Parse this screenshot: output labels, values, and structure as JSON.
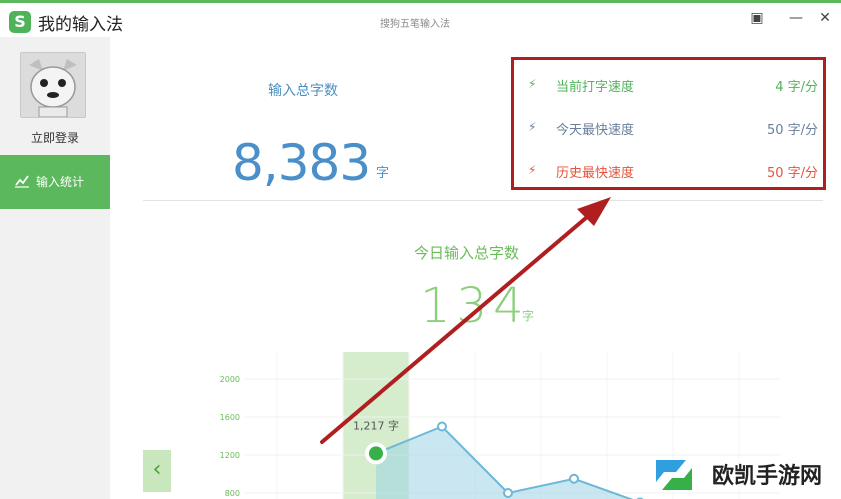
{
  "window": {
    "app_title": "我的输入法",
    "subtitle": "搜狗五笔输入法",
    "logo_letter": "S",
    "buttons": {
      "skin": "▣",
      "minimize": "—",
      "close": "✕"
    }
  },
  "sidebar": {
    "login_label": "立即登录",
    "nav_stats_label": "输入统计"
  },
  "totals": {
    "label": "输入总字数",
    "value": "8,383",
    "unit": "字"
  },
  "speeds": [
    {
      "name": "当前打字速度",
      "value": "4  字/分",
      "color": "#4fb35a"
    },
    {
      "name": "今天最快速度",
      "value": "50 字/分",
      "color": "#6a7f9c"
    },
    {
      "name": "历史最快速度",
      "value": "50 字/分",
      "color": "#e5533d"
    }
  ],
  "today": {
    "label": "今日输入总字数",
    "value": "134",
    "unit": "字"
  },
  "chart_data": {
    "type": "area",
    "y_ticks": [
      "2000",
      "1600",
      "1200",
      "800"
    ],
    "ylim": [
      600,
      2000
    ],
    "values": [
      null,
      1217,
      1500,
      800,
      950,
      700
    ],
    "highlight_index": 1,
    "highlight_label": "1,217 字",
    "nav_prev": "‹"
  },
  "watermark": {
    "text": "欧凯手游网"
  }
}
